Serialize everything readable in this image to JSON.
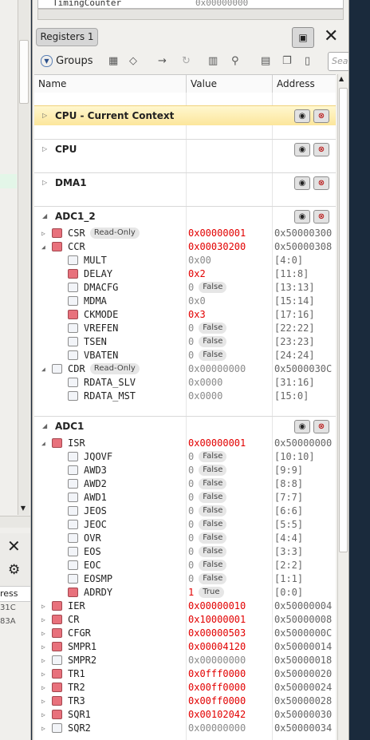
{
  "background_window": {
    "status_label": "ress",
    "values": [
      "31C",
      "83A"
    ]
  },
  "peek_row": {
    "name": "TimingCounter",
    "value": "0x00000000"
  },
  "panel": {
    "tab_title": "Registers 1"
  },
  "toolbar": {
    "groups_label": "Groups",
    "search_placeholder": "Sea"
  },
  "columns": {
    "name": "Name",
    "value": "Value",
    "address": "Address"
  },
  "groups": [
    {
      "name": "CPU - Current Context",
      "expanded": false,
      "selected": true
    },
    {
      "name": "CPU",
      "expanded": false
    },
    {
      "name": "DMA1",
      "expanded": false
    },
    {
      "name": "ADC1_2",
      "expanded": true
    },
    {
      "name": "ADC1",
      "expanded": true
    }
  ],
  "rows": [
    {
      "group": 3,
      "level": 1,
      "expander": "collapsed",
      "name": "CSR",
      "badge": "Read-Only",
      "value": "0x00000001",
      "value_changed": true,
      "address": "0x50000300",
      "red": true
    },
    {
      "group": 3,
      "level": 1,
      "expander": "expanded",
      "name": "CCR",
      "value": "0x00030200",
      "value_changed": true,
      "address": "0x50000308",
      "red": true
    },
    {
      "group": 3,
      "level": 2,
      "name": "MULT",
      "value": "0x00",
      "address": "[4:0]"
    },
    {
      "group": 3,
      "level": 2,
      "name": "DELAY",
      "value": "0x2",
      "value_changed": true,
      "address": "[11:8]",
      "red": true
    },
    {
      "group": 3,
      "level": 2,
      "name": "DMACFG",
      "value": "0",
      "tag": "False",
      "address": "[13:13]"
    },
    {
      "group": 3,
      "level": 2,
      "name": "MDMA",
      "value": "0x0",
      "address": "[15:14]"
    },
    {
      "group": 3,
      "level": 2,
      "name": "CKMODE",
      "value": "0x3",
      "value_changed": true,
      "address": "[17:16]",
      "red": true
    },
    {
      "group": 3,
      "level": 2,
      "name": "VREFEN",
      "value": "0",
      "tag": "False",
      "address": "[22:22]"
    },
    {
      "group": 3,
      "level": 2,
      "name": "TSEN",
      "value": "0",
      "tag": "False",
      "address": "[23:23]"
    },
    {
      "group": 3,
      "level": 2,
      "name": "VBATEN",
      "value": "0",
      "tag": "False",
      "address": "[24:24]"
    },
    {
      "group": 3,
      "level": 1,
      "expander": "expanded",
      "name": "CDR",
      "badge": "Read-Only",
      "value": "0x00000000",
      "address": "0x5000030C"
    },
    {
      "group": 3,
      "level": 2,
      "name": "RDATA_SLV",
      "value": "0x0000",
      "address": "[31:16]"
    },
    {
      "group": 3,
      "level": 2,
      "name": "RDATA_MST",
      "value": "0x0000",
      "address": "[15:0]"
    },
    {
      "group": 4,
      "level": 1,
      "expander": "expanded",
      "name": "ISR",
      "value": "0x00000001",
      "value_changed": true,
      "address": "0x50000000",
      "red": true
    },
    {
      "group": 4,
      "level": 2,
      "name": "JQOVF",
      "value": "0",
      "tag": "False",
      "address": "[10:10]"
    },
    {
      "group": 4,
      "level": 2,
      "name": "AWD3",
      "value": "0",
      "tag": "False",
      "address": "[9:9]"
    },
    {
      "group": 4,
      "level": 2,
      "name": "AWD2",
      "value": "0",
      "tag": "False",
      "address": "[8:8]"
    },
    {
      "group": 4,
      "level": 2,
      "name": "AWD1",
      "value": "0",
      "tag": "False",
      "address": "[7:7]"
    },
    {
      "group": 4,
      "level": 2,
      "name": "JEOS",
      "value": "0",
      "tag": "False",
      "address": "[6:6]"
    },
    {
      "group": 4,
      "level": 2,
      "name": "JEOC",
      "value": "0",
      "tag": "False",
      "address": "[5:5]"
    },
    {
      "group": 4,
      "level": 2,
      "name": "OVR",
      "value": "0",
      "tag": "False",
      "address": "[4:4]"
    },
    {
      "group": 4,
      "level": 2,
      "name": "EOS",
      "value": "0",
      "tag": "False",
      "address": "[3:3]"
    },
    {
      "group": 4,
      "level": 2,
      "name": "EOC",
      "value": "0",
      "tag": "False",
      "address": "[2:2]"
    },
    {
      "group": 4,
      "level": 2,
      "name": "EOSMP",
      "value": "0",
      "tag": "False",
      "address": "[1:1]"
    },
    {
      "group": 4,
      "level": 2,
      "name": "ADRDY",
      "value": "1",
      "value_changed": true,
      "tag": "True",
      "address": "[0:0]",
      "red": true
    },
    {
      "group": 4,
      "level": 1,
      "expander": "collapsed",
      "name": "IER",
      "value": "0x00000010",
      "value_changed": true,
      "address": "0x50000004",
      "red": true
    },
    {
      "group": 4,
      "level": 1,
      "expander": "collapsed",
      "name": "CR",
      "value": "0x10000001",
      "value_changed": true,
      "address": "0x50000008",
      "red": true
    },
    {
      "group": 4,
      "level": 1,
      "expander": "collapsed",
      "name": "CFGR",
      "value": "0x00000503",
      "value_changed": true,
      "address": "0x5000000C",
      "red": true
    },
    {
      "group": 4,
      "level": 1,
      "expander": "collapsed",
      "name": "SMPR1",
      "value": "0x00004120",
      "value_changed": true,
      "address": "0x50000014",
      "red": true
    },
    {
      "group": 4,
      "level": 1,
      "expander": "collapsed",
      "name": "SMPR2",
      "value": "0x00000000",
      "address": "0x50000018"
    },
    {
      "group": 4,
      "level": 1,
      "expander": "collapsed",
      "name": "TR1",
      "value": "0x0fff0000",
      "value_changed": true,
      "address": "0x50000020",
      "red": true
    },
    {
      "group": 4,
      "level": 1,
      "expander": "collapsed",
      "name": "TR2",
      "value": "0x00ff0000",
      "value_changed": true,
      "address": "0x50000024",
      "red": true
    },
    {
      "group": 4,
      "level": 1,
      "expander": "collapsed",
      "name": "TR3",
      "value": "0x00ff0000",
      "value_changed": true,
      "address": "0x50000028",
      "red": true
    },
    {
      "group": 4,
      "level": 1,
      "expander": "collapsed",
      "name": "SQR1",
      "value": "0x00102042",
      "value_changed": true,
      "address": "0x50000030",
      "red": true
    },
    {
      "group": 4,
      "level": 1,
      "expander": "collapsed",
      "name": "SQR2",
      "value": "0x00000000",
      "address": "0x50000034"
    }
  ],
  "colors": {
    "changed_value": "#e20000",
    "selected_group": "#fce69b",
    "register_marker": "#e8717c"
  }
}
